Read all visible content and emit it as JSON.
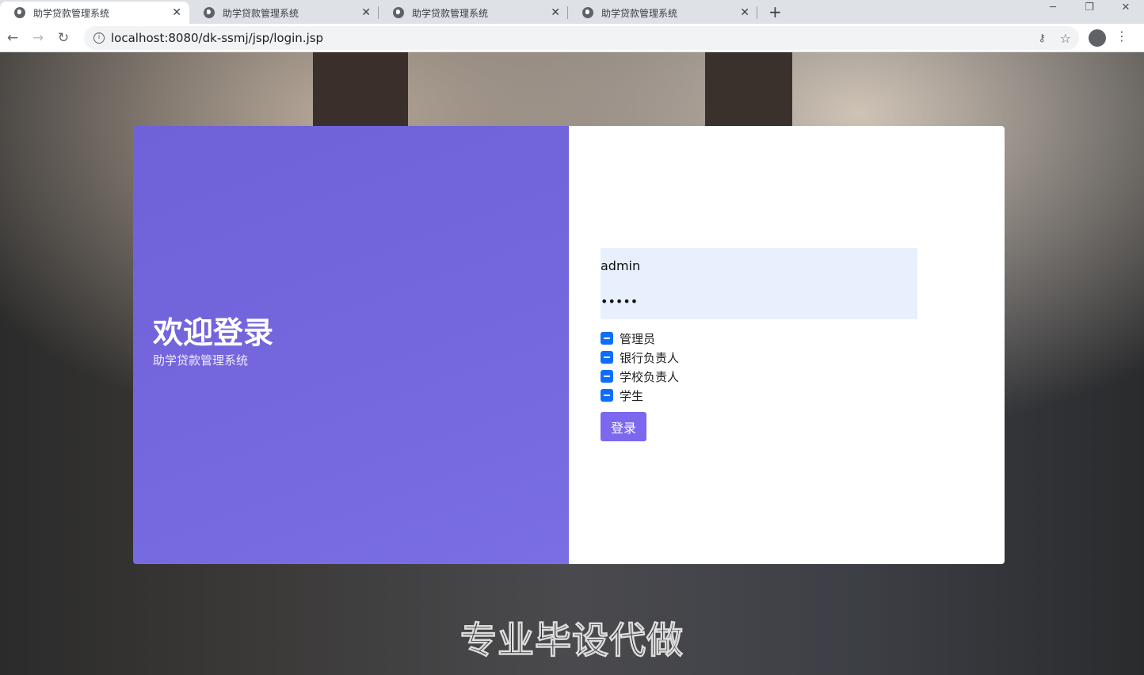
{
  "browser": {
    "tabs": [
      {
        "title": "助学贷款管理系统"
      },
      {
        "title": "助学贷款管理系统"
      },
      {
        "title": "助学贷款管理系统"
      },
      {
        "title": "助学贷款管理系统"
      }
    ],
    "url": "localhost:8080/dk-ssmj/jsp/login.jsp"
  },
  "login": {
    "welcome": "欢迎登录",
    "subtitle": "助学贷款管理系统",
    "username": "admin",
    "password": "admin",
    "roles": [
      {
        "label": "管理员"
      },
      {
        "label": "银行负责人"
      },
      {
        "label": "学校负责人"
      },
      {
        "label": "学生"
      }
    ],
    "submit": "登录"
  },
  "watermark": "专业毕设代做",
  "colors": {
    "accent": "#7b68ee",
    "checkbox": "#0d6efd",
    "input_bg": "#e8f0fe"
  }
}
